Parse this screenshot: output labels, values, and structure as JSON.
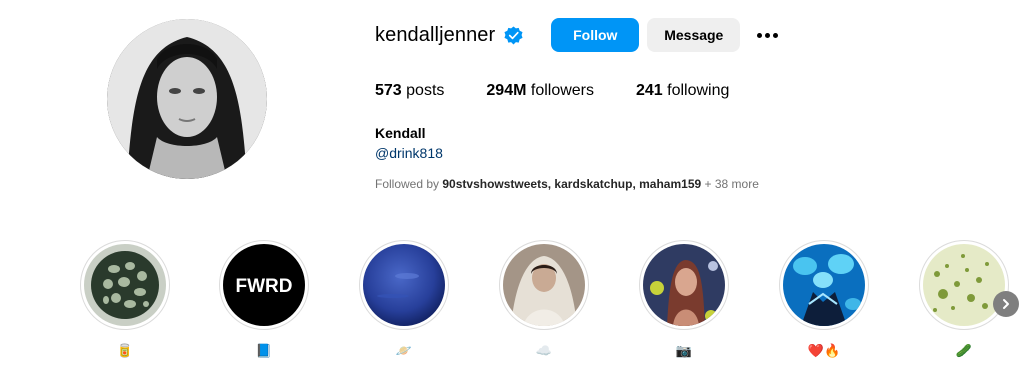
{
  "profile": {
    "username": "kendalljenner",
    "verified_icon": "verified-badge-icon",
    "follow_label": "Follow",
    "message_label": "Message",
    "more_icon": "more-options-icon",
    "full_name": "Kendall",
    "handle_link": "@drink818"
  },
  "stats": {
    "posts_count": "573",
    "posts_label": " posts",
    "followers_count": "294M",
    "followers_label": " followers",
    "following_count": "241",
    "following_label": " following"
  },
  "followed_by": {
    "prefix": "Followed by ",
    "users": "90stvshowstweets, kardskatchup, maham159",
    "suffix": " + 38 more"
  },
  "highlights": [
    {
      "label": "🥫",
      "thumb": "snake-ball"
    },
    {
      "label": "📘",
      "thumb": "fwrd-logo",
      "thumb_text": "FWRD"
    },
    {
      "label": "🪐",
      "thumb": "blue-planet"
    },
    {
      "label": "☁️",
      "thumb": "bride-photo"
    },
    {
      "label": "📷",
      "thumb": "woman-portrait"
    },
    {
      "label": "❤️🔥",
      "thumb": "jellyfish"
    },
    {
      "label": "🥒",
      "thumb": "green-cells"
    }
  ],
  "next_icon": "chevron-right-icon",
  "colors": {
    "follow_button": "#0095f6",
    "message_button": "#efefef",
    "verified": "#0095f6",
    "link": "#00376b",
    "muted": "#737373"
  }
}
